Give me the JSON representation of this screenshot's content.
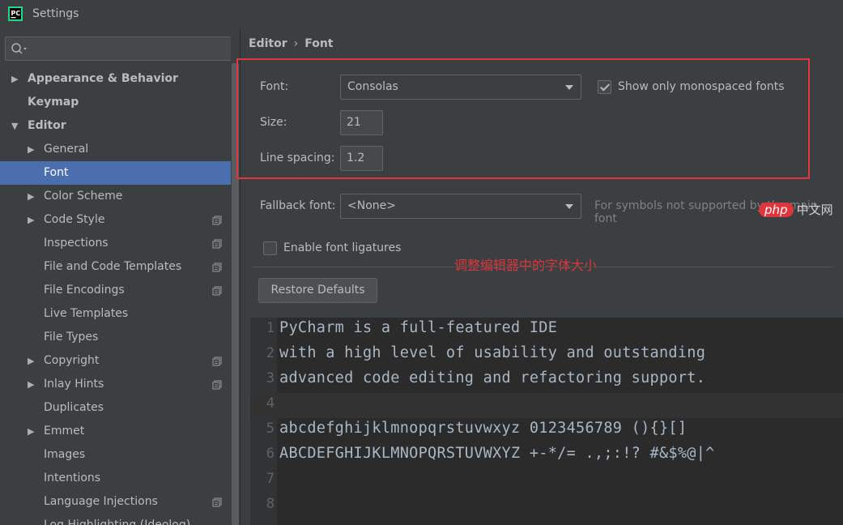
{
  "window": {
    "title": "Settings"
  },
  "colors": {
    "accent": "#4b6eaf",
    "highlight_border": "#e0353a",
    "annotation": "#e0353a"
  },
  "sidebar": {
    "search_placeholder": "",
    "items": [
      {
        "label": "Appearance & Behavior",
        "arrow": "▶",
        "level": 0,
        "bold": true
      },
      {
        "label": "Keymap",
        "arrow": "",
        "level": 0,
        "bold": true
      },
      {
        "label": "Editor",
        "arrow": "▼",
        "level": 0,
        "bold": true
      },
      {
        "label": "General",
        "arrow": "▶",
        "level": 1
      },
      {
        "label": "Font",
        "arrow": "",
        "level": 1,
        "selected": true
      },
      {
        "label": "Color Scheme",
        "arrow": "▶",
        "level": 1
      },
      {
        "label": "Code Style",
        "arrow": "▶",
        "level": 1,
        "copy": true
      },
      {
        "label": "Inspections",
        "arrow": "",
        "level": 1,
        "copy": true
      },
      {
        "label": "File and Code Templates",
        "arrow": "",
        "level": 1,
        "copy": true
      },
      {
        "label": "File Encodings",
        "arrow": "",
        "level": 1,
        "copy": true
      },
      {
        "label": "Live Templates",
        "arrow": "",
        "level": 1
      },
      {
        "label": "File Types",
        "arrow": "",
        "level": 1
      },
      {
        "label": "Copyright",
        "arrow": "▶",
        "level": 1,
        "copy": true
      },
      {
        "label": "Inlay Hints",
        "arrow": "▶",
        "level": 1,
        "copy": true
      },
      {
        "label": "Duplicates",
        "arrow": "",
        "level": 1
      },
      {
        "label": "Emmet",
        "arrow": "▶",
        "level": 1
      },
      {
        "label": "Images",
        "arrow": "",
        "level": 1
      },
      {
        "label": "Intentions",
        "arrow": "",
        "level": 1
      },
      {
        "label": "Language Injections",
        "arrow": "",
        "level": 1,
        "copy": true
      },
      {
        "label": "Log Highlighting (Ideolog)",
        "arrow": "",
        "level": 1
      }
    ]
  },
  "main": {
    "breadcrumb": {
      "part1": "Editor",
      "separator": "›",
      "part2": "Font"
    },
    "font_label": "Font:",
    "font_value": "Consolas",
    "monospaced_label": "Show only monospaced fonts",
    "monospaced_checked": true,
    "size_label": "Size:",
    "size_value": "21",
    "line_spacing_label": "Line spacing:",
    "line_spacing_value": "1.2",
    "fallback_label": "Fallback font:",
    "fallback_value": "<None>",
    "fallback_hint": "For symbols not supported by the main font",
    "ligatures_label": "Enable font ligatures",
    "ligatures_checked": false,
    "annotation": "调整编辑器中的字体大小",
    "restore_label": "Restore Defaults"
  },
  "preview": {
    "lines": [
      {
        "num": "1",
        "text": "PyCharm is a full-featured IDE"
      },
      {
        "num": "2",
        "text": "with a high level of usability and outstanding"
      },
      {
        "num": "3",
        "text": "advanced code editing and refactoring support."
      },
      {
        "num": "4",
        "text": ""
      },
      {
        "num": "5",
        "text": "abcdefghijklmnopqrstuvwxyz 0123456789 (){}[]"
      },
      {
        "num": "6",
        "text": "ABCDEFGHIJKLMNOPQRSTUVWXYZ +-*/= .,;:!? #&$%@|^"
      },
      {
        "num": "7",
        "text": ""
      },
      {
        "num": "8",
        "text": ""
      }
    ],
    "current_line": 4
  },
  "watermark": {
    "logo": "php",
    "text": "中文网"
  }
}
